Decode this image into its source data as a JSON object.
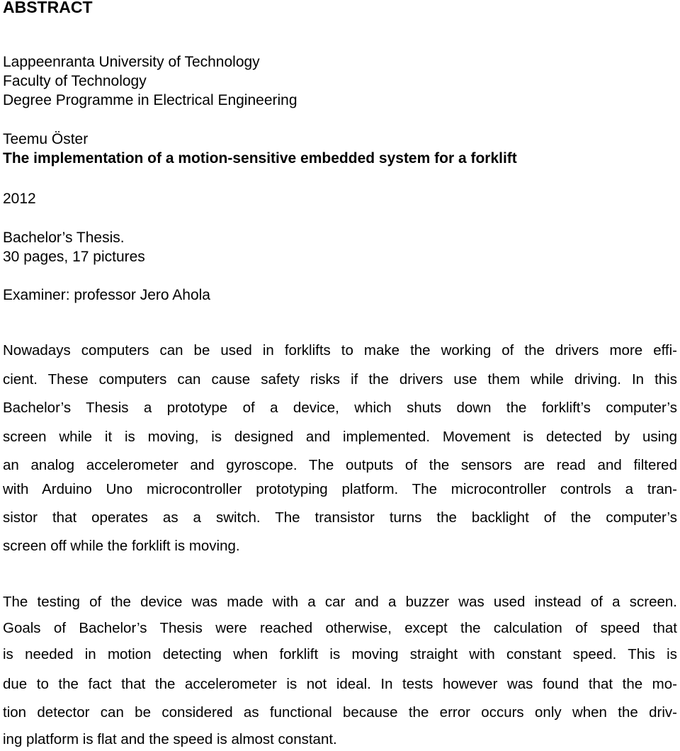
{
  "heading": "ABSTRACT",
  "institution": {
    "university": "Lappeenranta University of Technology",
    "faculty": "Faculty of Technology",
    "programme": "Degree Programme in Electrical Engineering"
  },
  "author": "Teemu Öster",
  "title": "The implementation of a motion-sensitive embedded system for a forklift",
  "year": "2012",
  "thesis_type": "Bachelor’s Thesis.",
  "extent": "30 pages, 17 pictures",
  "examiner": "Examiner: professor Jero Ahola",
  "paragraphs": [
    {
      "lines": [
        "Nowadays computers can be used in forklifts to make the working of the drivers more effi-",
        "cient. These computers can cause safety risks if the drivers use them while driving. In this",
        "Bachelor’s Thesis a prototype of a device, which shuts down the forklift’s computer’s",
        "screen while it is moving, is designed and implemented. Movement is detected by using",
        "an analog accelerometer and gyroscope. The outputs of the sensors are read and filtered",
        "with Arduino Uno microcontroller prototyping platform. The microcontroller controls a tran-",
        "sistor that operates as a switch. The transistor turns the backlight of the computer’s",
        "screen off while the forklift is moving."
      ]
    },
    {
      "lines": [
        "The testing of the device was made with a car and a buzzer was used instead of a screen.",
        "Goals of Bachelor’s Thesis were reached otherwise, except the calculation of speed that",
        "is needed in motion detecting when forklift is moving straight with constant speed. This is",
        "due to the fact that the accelerometer is not ideal. In tests however was found that the mo-",
        "tion detector can be considered as functional because the error occurs only when the driv-",
        "ing platform is flat and the speed is almost constant."
      ]
    }
  ]
}
